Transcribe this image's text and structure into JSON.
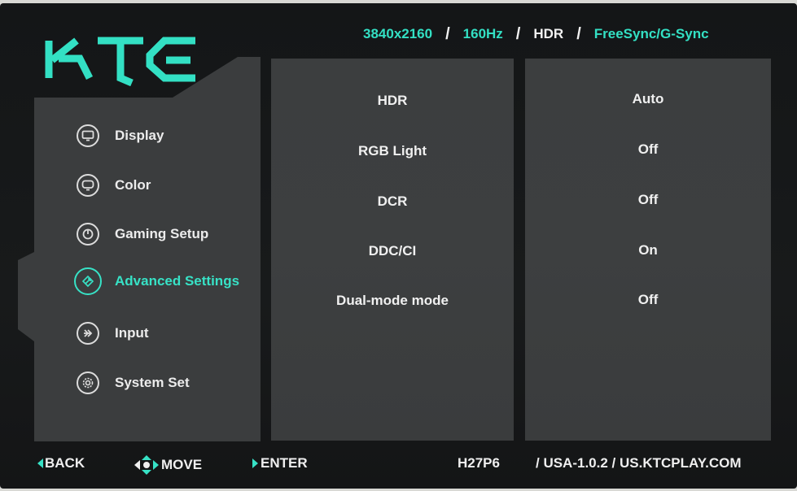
{
  "header": {
    "logo_text": "KTC",
    "specs": [
      "3840x2160",
      "160Hz",
      "HDR",
      "FreeSync/G-Sync"
    ],
    "separator": "/"
  },
  "nav": {
    "items": [
      {
        "label": "Display",
        "icon": "monitor-icon"
      },
      {
        "label": "Color",
        "icon": "color-icon"
      },
      {
        "label": "Gaming Setup",
        "icon": "gaming-icon"
      },
      {
        "label": "Advanced Settings",
        "icon": "advanced-settings-icon",
        "active": true
      },
      {
        "label": "Input",
        "icon": "input-icon"
      },
      {
        "label": "System Set",
        "icon": "system-gear-icon"
      }
    ]
  },
  "settings": {
    "rows": [
      {
        "label": "HDR",
        "value": "Auto"
      },
      {
        "label": "RGB Light",
        "value": "Off"
      },
      {
        "label": "DCR",
        "value": "Off"
      },
      {
        "label": "DDC/CI",
        "value": "On"
      },
      {
        "label": "Dual-mode mode",
        "value": "Off"
      }
    ]
  },
  "footer": {
    "back": "BACK",
    "move": "MOVE",
    "enter": "ENTER",
    "model": "H27P6",
    "firmware": "/ USA-1.0.2 / US.KTCPLAY.COM"
  },
  "colors": {
    "accent": "#37e2c6",
    "panel": "#3c3e3f",
    "background": "#161819",
    "text": "#f0f0f0"
  }
}
